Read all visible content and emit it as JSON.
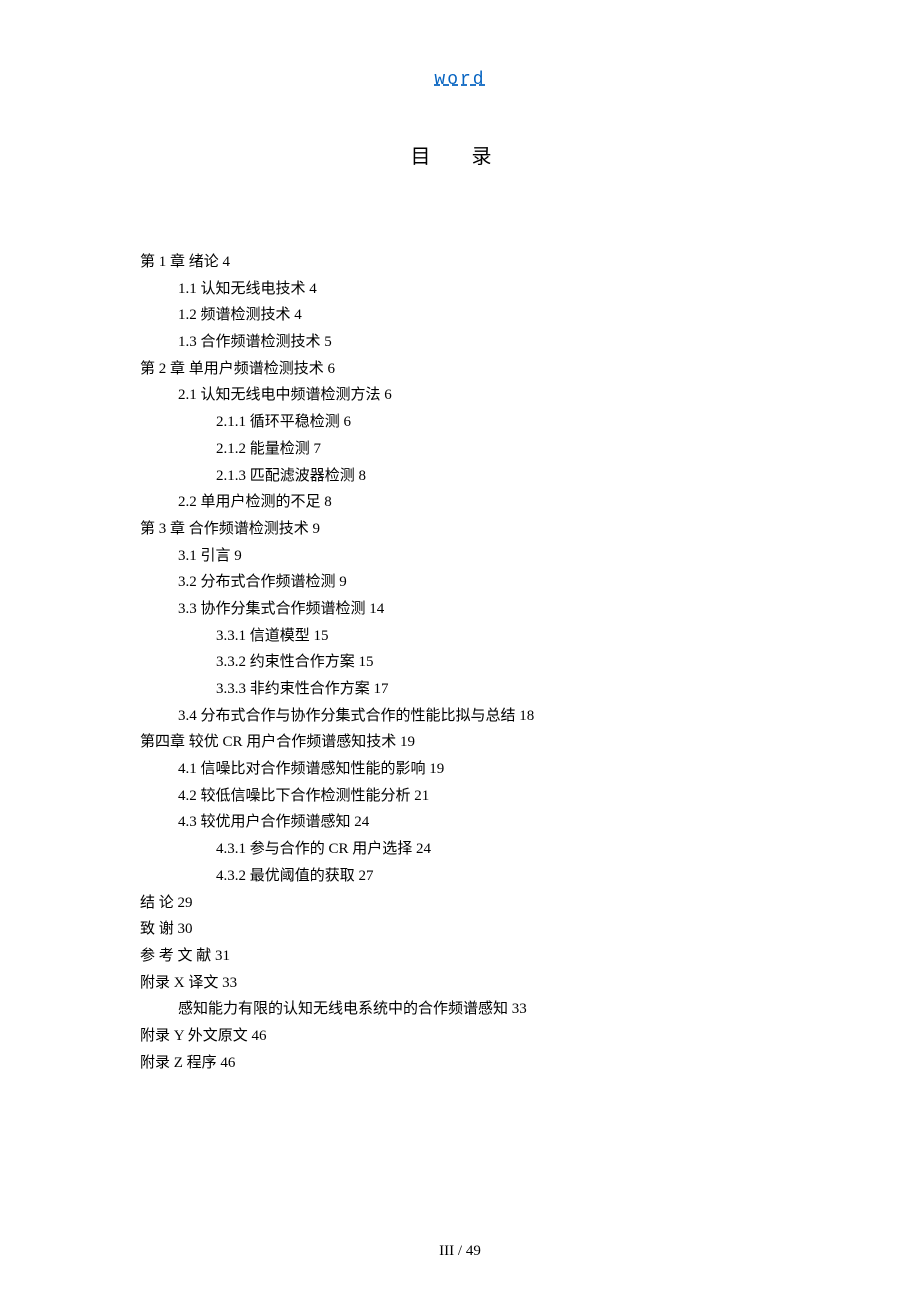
{
  "header": {
    "link_text": "word"
  },
  "title": "目  录",
  "toc": [
    {
      "level": 0,
      "text": "第 1 章  绪论 4"
    },
    {
      "level": 1,
      "text": "1.1  认知无线电技术 4"
    },
    {
      "level": 1,
      "text": "1.2  频谱检测技术 4"
    },
    {
      "level": 1,
      "text": "1.3  合作频谱检测技术 5"
    },
    {
      "level": 0,
      "text": "第 2 章  单用户频谱检测技术 6"
    },
    {
      "level": 1,
      "text": "2.1  认知无线电中频谱检测方法 6"
    },
    {
      "level": 2,
      "text": "2.1.1  循环平稳检测 6"
    },
    {
      "level": 2,
      "text": "2.1.2  能量检测 7"
    },
    {
      "level": 2,
      "text": "2.1.3  匹配滤波器检测 8"
    },
    {
      "level": 1,
      "text": "2.2  单用户检测的不足 8"
    },
    {
      "level": 0,
      "text": "第 3 章    合作频谱检测技术 9"
    },
    {
      "level": 1,
      "text": "3.1  引言 9"
    },
    {
      "level": 1,
      "text": "3.2  分布式合作频谱检测 9"
    },
    {
      "level": 1,
      "text": "3.3   协作分集式合作频谱检测 14"
    },
    {
      "level": 2,
      "text": "3.3.1  信道模型 15"
    },
    {
      "level": 2,
      "text": "3.3.2  约束性合作方案 15"
    },
    {
      "level": 2,
      "text": "3.3.3  非约束性合作方案 17"
    },
    {
      "level": 1,
      "text": "3.4  分布式合作与协作分集式合作的性能比拟与总结 18"
    },
    {
      "level": 0,
      "text": "第四章  较优 CR  用户合作频谱感知技术 19"
    },
    {
      "level": 1,
      "text": "4.1  信噪比对合作频谱感知性能的影响 19"
    },
    {
      "level": 1,
      "text": "4.2  较低信噪比下合作检测性能分析 21"
    },
    {
      "level": 1,
      "text": "4.3  较优用户合作频谱感知 24"
    },
    {
      "level": 2,
      "text": "4.3.1  参与合作的 CR 用户选择 24"
    },
    {
      "level": 2,
      "text": "4.3.2  最优阈值的获取 27"
    },
    {
      "level": 0,
      "text": "结    论 29"
    },
    {
      "level": 0,
      "text": "致    谢 30"
    },
    {
      "level": 0,
      "text": "参  考  文  献 31"
    },
    {
      "level": 0,
      "text": "附录 X    译文 33"
    },
    {
      "level": 1,
      "text": "感知能力有限的认知无线电系统中的合作频谱感知 33"
    },
    {
      "level": 0,
      "text": "附录 Y    外文原文 46"
    },
    {
      "level": 0,
      "text": "附录 Z    程序 46"
    }
  ],
  "footer": {
    "page_indicator": "III  / 49"
  }
}
